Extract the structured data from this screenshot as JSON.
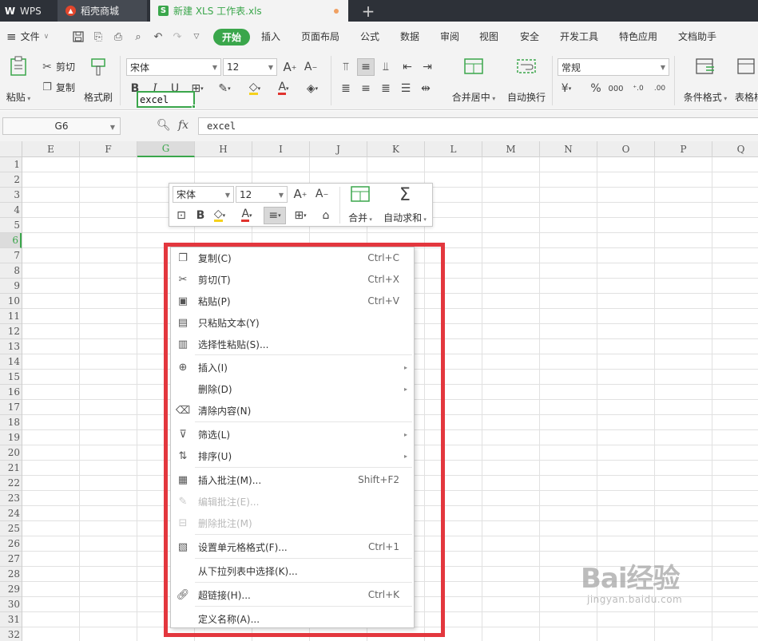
{
  "tabs": [
    {
      "label": "WPS",
      "icon": "wps-logo-icon"
    },
    {
      "label": "稻壳商城",
      "icon": "docer-flame-icon"
    },
    {
      "label": "新建 XLS 工作表.xls",
      "icon": "sheet-file-icon",
      "active": true,
      "unsaved": true
    }
  ],
  "menubar": {
    "file": "文件",
    "items": [
      "开始",
      "插入",
      "页面布局",
      "公式",
      "数据",
      "审阅",
      "视图",
      "安全",
      "开发工具",
      "特色应用",
      "文档助手"
    ],
    "active": "开始"
  },
  "ribbon": {
    "paste": "粘贴",
    "cut": "剪切",
    "copy": "复制",
    "format_painter": "格式刷",
    "font_name": "宋体",
    "font_size": "12",
    "merge_center": "合并居中",
    "wrap_text": "自动换行",
    "number_format": "常规",
    "conditional_format": "条件格式",
    "table_style": "表格样式",
    "colors": {
      "font_color": "#e0332e",
      "fill_color": "#f5d11c",
      "accent": "#3aa64b"
    }
  },
  "formula_bar": {
    "cell_ref": "G6",
    "fx": "fx",
    "value": "excel"
  },
  "grid": {
    "columns": [
      "E",
      "F",
      "G",
      "H",
      "I",
      "J",
      "K",
      "L",
      "M",
      "N",
      "O",
      "P",
      "Q"
    ],
    "selected_column": "G",
    "rows": [
      "1",
      "2",
      "3",
      "4",
      "5",
      "6",
      "7",
      "8",
      "9",
      "10",
      "11",
      "12",
      "13",
      "14",
      "15",
      "16",
      "17",
      "18",
      "19",
      "20",
      "21",
      "22",
      "23",
      "24",
      "25",
      "26",
      "27",
      "28",
      "29",
      "30",
      "31",
      "32"
    ],
    "selected_row": "6",
    "active_cell_text": "excel"
  },
  "mini_toolbar": {
    "font_name": "宋体",
    "font_size": "12",
    "merge": "合并",
    "autosum": "自动求和"
  },
  "context_menu": {
    "items": [
      {
        "label": "复制(C)",
        "shortcut": "Ctrl+C",
        "icon": "copy-icon"
      },
      {
        "label": "剪切(T)",
        "shortcut": "Ctrl+X",
        "icon": "scissors-icon"
      },
      {
        "label": "粘贴(P)",
        "shortcut": "Ctrl+V",
        "icon": "paste-icon"
      },
      {
        "label": "只粘贴文本(Y)",
        "icon": "paste-text-icon"
      },
      {
        "label": "选择性粘贴(S)...",
        "icon": "paste-special-icon"
      },
      {
        "label": "插入(I)",
        "icon": "insert-icon",
        "submenu": true
      },
      {
        "label": "删除(D)",
        "submenu": true
      },
      {
        "label": "清除内容(N)",
        "icon": "eraser-icon"
      },
      {
        "label": "筛选(L)",
        "icon": "filter-icon",
        "submenu": true
      },
      {
        "label": "排序(U)",
        "icon": "sort-icon",
        "submenu": true
      },
      {
        "label": "插入批注(M)...",
        "shortcut": "Shift+F2",
        "icon": "comment-add-icon"
      },
      {
        "label": "编辑批注(E)...",
        "icon": "comment-edit-icon",
        "disabled": true
      },
      {
        "label": "删除批注(M)",
        "icon": "comment-delete-icon",
        "disabled": true
      },
      {
        "label": "设置单元格格式(F)...",
        "shortcut": "Ctrl+1",
        "icon": "format-cells-icon"
      },
      {
        "label": "从下拉列表中选择(K)..."
      },
      {
        "label": "超链接(H)...",
        "shortcut": "Ctrl+K",
        "icon": "link-icon"
      },
      {
        "label": "定义名称(A)..."
      }
    ]
  },
  "highlight_color": "#e3373e",
  "watermark": {
    "brand": "Bai经验",
    "domain": "jingyan.baidu.com"
  }
}
